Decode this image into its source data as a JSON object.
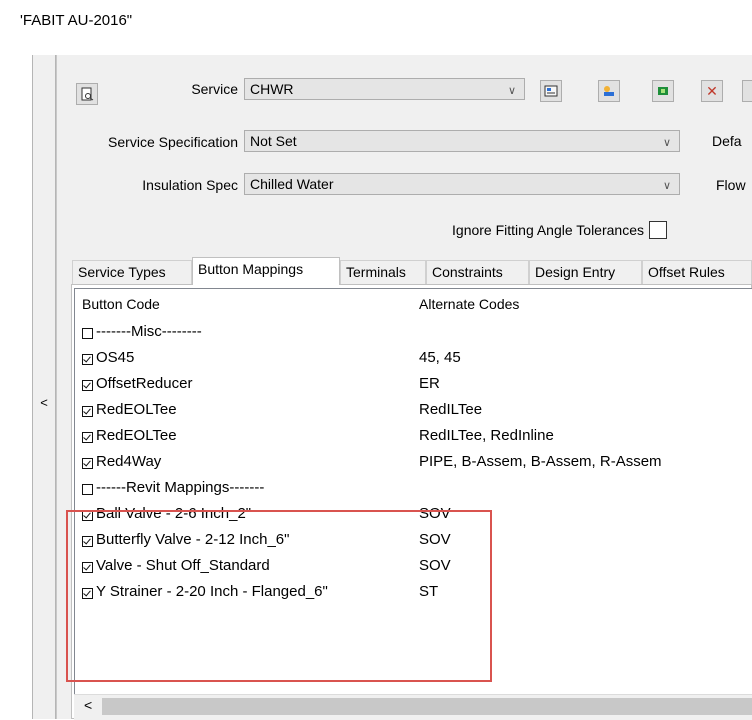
{
  "window": {
    "title": "'FABIT AU-2016\""
  },
  "sidebar": {
    "collapse_label": "<"
  },
  "toolbar": {
    "service_label": "Service",
    "service_value": "CHWR",
    "spec_label": "Service Specification",
    "spec_value": "Not Set",
    "insulation_label": "Insulation Spec",
    "insulation_value": "Chilled Water",
    "default_label": "Defa",
    "flow_label": "Flow",
    "ignore_label": "Ignore Fitting Angle Tolerances",
    "delete_glyph": "✕"
  },
  "tabs": [
    {
      "label": "Service Types"
    },
    {
      "label": "Button Mappings"
    },
    {
      "label": "Terminals"
    },
    {
      "label": "Constraints"
    },
    {
      "label": "Design Entry"
    },
    {
      "label": "Offset Rules"
    }
  ],
  "active_tab": "Button Mappings",
  "grid": {
    "columns": [
      "Button Code",
      "Alternate Codes"
    ],
    "rows": [
      {
        "checked": false,
        "code": "-------Misc--------",
        "alt": ""
      },
      {
        "checked": true,
        "code": "OS45",
        "alt": "45, 45"
      },
      {
        "checked": true,
        "code": "OffsetReducer",
        "alt": "ER"
      },
      {
        "checked": true,
        "code": "RedEOLTee",
        "alt": "RedILTee"
      },
      {
        "checked": true,
        "code": "RedEOLTee",
        "alt": "RedILTee, RedInline"
      },
      {
        "checked": true,
        "code": "Red4Way",
        "alt": "PIPE, B-Assem, B-Assem, R-Assem"
      },
      {
        "checked": false,
        "code": "------Revit Mappings-------",
        "alt": ""
      },
      {
        "checked": true,
        "code": "Ball Valve - 2-6 Inch_2\"",
        "alt": "SOV"
      },
      {
        "checked": true,
        "code": "Butterfly Valve - 2-12 Inch_6\"",
        "alt": "SOV"
      },
      {
        "checked": true,
        "code": "Valve - Shut Off_Standard",
        "alt": "SOV"
      },
      {
        "checked": true,
        "code": "Y Strainer - 2-20 Inch - Flanged_6\"",
        "alt": "ST"
      }
    ]
  },
  "scrollbar": {
    "left_arrow": "<"
  },
  "colors": {
    "highlight": "#d9534f",
    "panel": "#f0f0f0"
  }
}
